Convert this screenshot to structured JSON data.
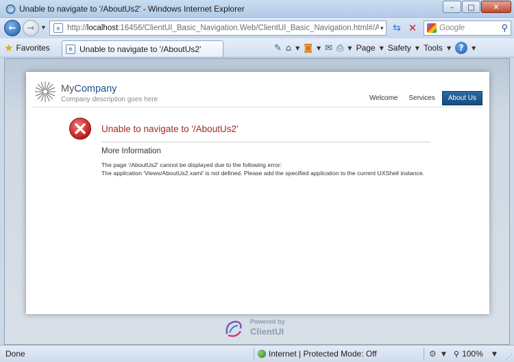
{
  "window": {
    "title": "Unable to navigate to '/AboutUs2' - Windows Internet Explorer",
    "minimize_icon": "minimize-icon",
    "maximize_icon": "maximize-icon",
    "close_icon": "close-icon"
  },
  "address_bar": {
    "url_prefix": "http://",
    "url_host": "localhost",
    "url_rest": ":16456/ClientUI_Basic_Navigation.Web/ClientUI_Basic_Navigation.html#/AboutU",
    "search_placeholder": "Google"
  },
  "command_bar": {
    "favorites_label": "Favorites",
    "tab_label": "Unable to navigate to '/AboutUs2'",
    "page_label": "Page",
    "safety_label": "Safety",
    "tools_label": "Tools"
  },
  "site": {
    "brand_my": "My",
    "brand_company": "Company",
    "tagline": "Company description goes here",
    "nav": [
      {
        "label": "Welcome",
        "active": false
      },
      {
        "label": "Services",
        "active": false
      },
      {
        "label": "About Us",
        "active": true
      }
    ]
  },
  "error": {
    "title": "Unable to navigate to '/AboutUs2'",
    "more_info_title": "More Information",
    "line1": "The page '/AboutUs2' cannot be displayed due to the following error:",
    "line2": "The application 'Views/AboutUs2.xaml' is not defined. Please add the specified application to the current UXShell instance."
  },
  "footer": {
    "powered_by": "Powered by",
    "product": "ClientUI"
  },
  "status_bar": {
    "status_text": "Done",
    "zone_text": "Internet | Protected Mode: Off",
    "zoom": "100%"
  },
  "colors": {
    "active_nav": "#1f5d96",
    "error_title": "#9c2a22",
    "error_icon": "#d22b2b"
  }
}
